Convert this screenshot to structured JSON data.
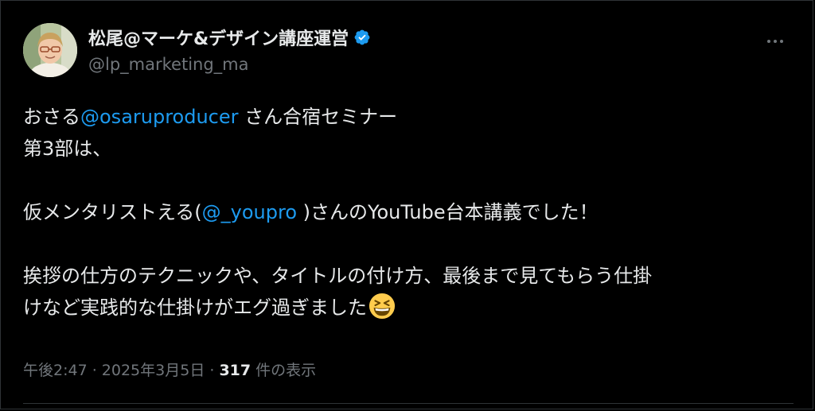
{
  "author": {
    "display_name": "松尾@マーケ&デザイン講座運営",
    "handle": "@lp_marketing_ma",
    "avatar_icon": "user-avatar",
    "verified_icon": "verified-badge-icon"
  },
  "tweet": {
    "line1_prefix": "おさる",
    "line1_mention": "@osaruproducer",
    "line1_suffix": " さん合宿セミナー",
    "line2": "第3部は、",
    "line3_prefix": "仮メンタリストえる(",
    "line3_mention": "@_youpro",
    "line3_suffix": " )さんのYouTube台本講義でした！",
    "line4": "挨拶の仕方のテクニックや、タイトルの付け方、最後まで見てもらう仕掛",
    "line5": "けなど実践的な仕掛けがエグ過ぎました",
    "emoji": "grinning-squinting-face-emoji"
  },
  "meta": {
    "time": "午後2:47",
    "sep1": " · ",
    "date": "2025年3月5日",
    "sep2": " · ",
    "views_count": "317",
    "views_label": " 件の表示"
  },
  "colors": {
    "background": "#000000",
    "text": "#e7e9ea",
    "secondary": "#71767b",
    "link": "#1d9bf0",
    "verified": "#1d9bf0"
  }
}
